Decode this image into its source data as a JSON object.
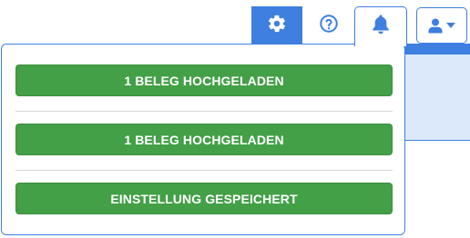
{
  "colors": {
    "accent": "#3e7fe0",
    "success": "#43a047",
    "panel_tint": "#dbe9fb"
  },
  "toolbar": {
    "settings_icon": "gear-icon",
    "help_icon": "question-circle-icon",
    "notifications_icon": "bell-icon",
    "user_icon": "user-icon",
    "user_menu_caret": "caret-down-icon"
  },
  "notifications": {
    "items": [
      {
        "label": "1 BELEG HOCHGELADEN"
      },
      {
        "label": "1 BELEG HOCHGELADEN"
      },
      {
        "label": "EINSTELLUNG GESPEICHERT"
      }
    ]
  }
}
